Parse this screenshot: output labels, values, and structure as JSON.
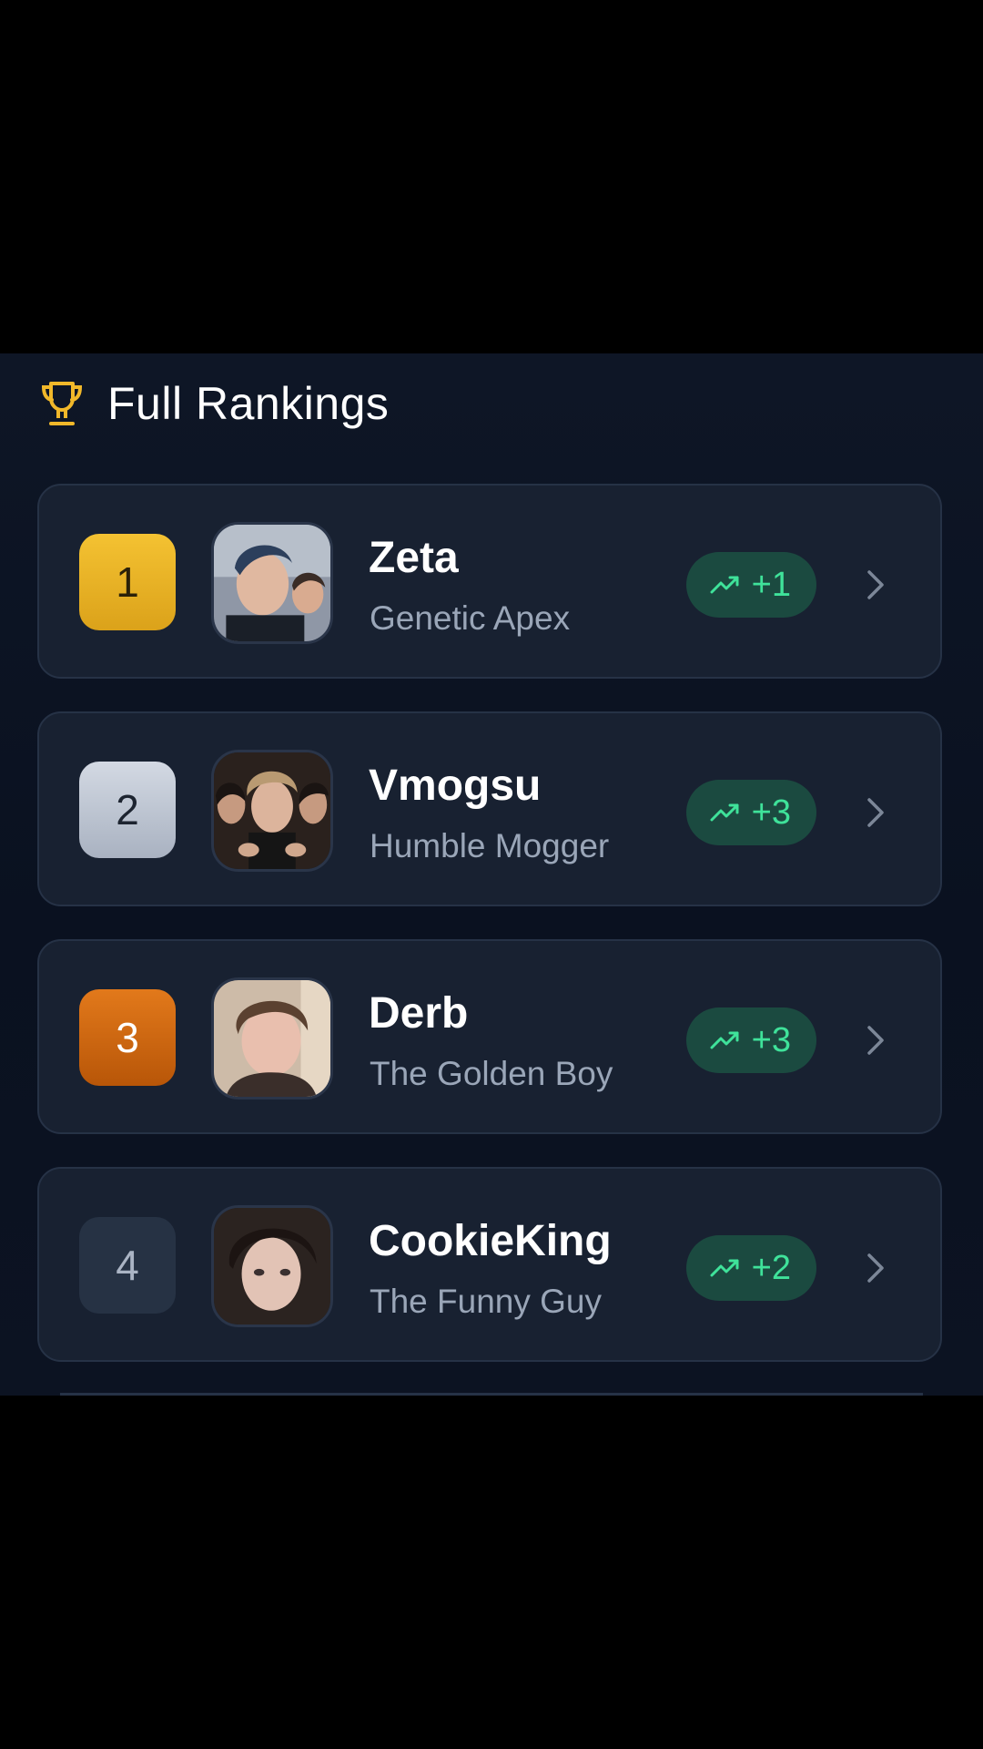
{
  "header": {
    "icon": "trophy-icon",
    "title": "Full Rankings"
  },
  "colors": {
    "gold": "#f4c232",
    "silver": "#c3cad6",
    "bronze": "#d46a12",
    "trend_green": "#3fe29a",
    "trend_bg": "#1b4a40"
  },
  "rankings": [
    {
      "rank": "1",
      "name": "Zeta",
      "title": "Genetic Apex",
      "change": "+1"
    },
    {
      "rank": "2",
      "name": "Vmogsu",
      "title": "Humble Mogger",
      "change": "+3"
    },
    {
      "rank": "3",
      "name": "Derb",
      "title": "The Golden Boy",
      "change": "+3"
    },
    {
      "rank": "4",
      "name": "CookieKing",
      "title": "The Funny Guy",
      "change": "+2"
    }
  ]
}
